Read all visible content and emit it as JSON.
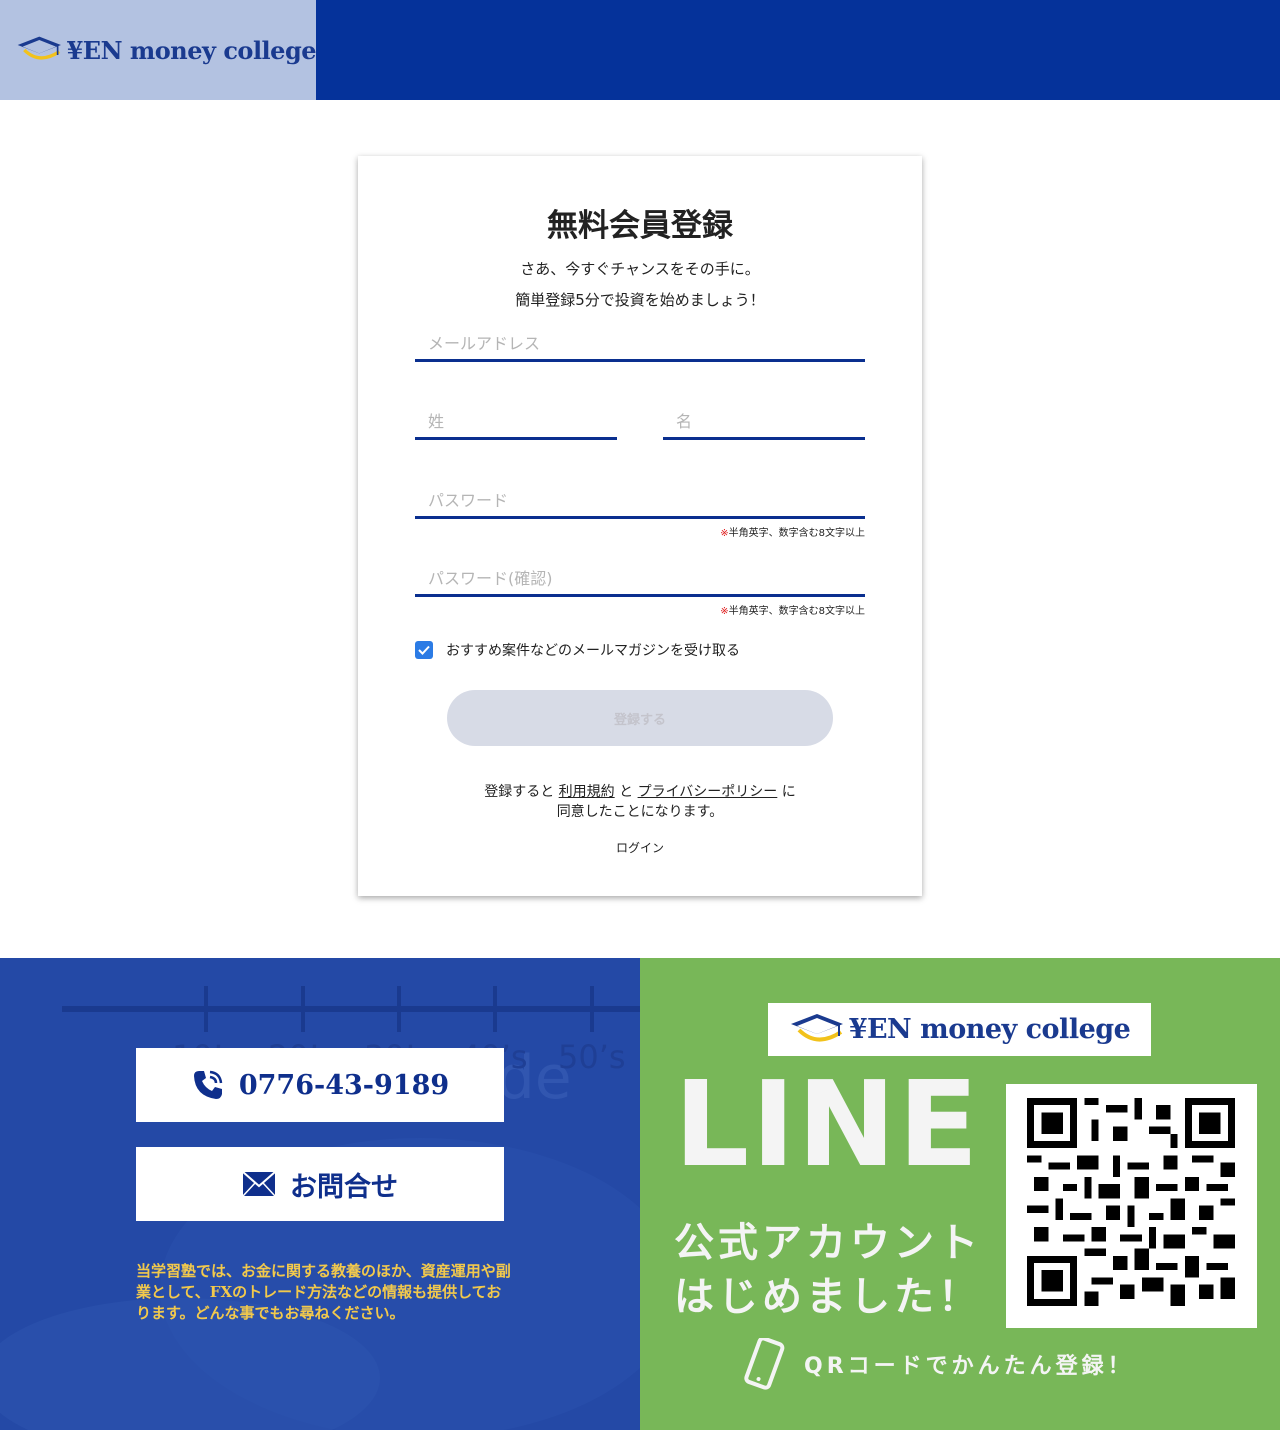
{
  "header": {
    "logo_text": "¥EN money college"
  },
  "form": {
    "title": "無料会員登録",
    "subtitle_1": "さあ、今すぐチャンスをその手に。",
    "subtitle_2": "簡単登録5分で投資を始めましょう！",
    "email_placeholder": "メールアドレス",
    "last_name_placeholder": "姓",
    "first_name_placeholder": "名",
    "password_placeholder": "パスワード",
    "password_confirm_placeholder": "パスワード(確認)",
    "password_note_mark": "※",
    "password_note": "半角英字、数字含む8文字以上",
    "newsletter_label": "おすすめ案件などのメールマガジンを受け取る",
    "newsletter_checked": true,
    "submit_label": "登録する",
    "terms_prefix": "登録すると",
    "terms_link": "利用規約",
    "terms_and": "と",
    "privacy_link": "プライバシーポリシー",
    "terms_suffix": "に",
    "terms_line2": "同意したことになります。",
    "login_link": "ログイン"
  },
  "footer": {
    "phone": "0776-43-9189",
    "contact_label": "お問合せ",
    "description": "当学習塾では、お金に関する教養のほか、資産運用や副業として、FXのトレード方法などの情報も提供しております。どんな事でもお尋ねください。",
    "ruler_labels": [
      "10’s",
      "20’s",
      "30’s",
      "40’s",
      "50’s"
    ],
    "line_logo_text": "¥EN money college",
    "line_title": "LINE",
    "line_sub_1": "公式アカウント",
    "line_sub_2": "はじめました！",
    "qr_text": "QRコードでかんたん登録！"
  },
  "colors": {
    "header_bg": "#05329a",
    "logo_bg": "#b3c2e1",
    "field_underline": "#0a2f8f",
    "footer_left_bg": "#2449a6",
    "footer_right_bg": "#78b758",
    "footer_text": "#f2c94c"
  }
}
